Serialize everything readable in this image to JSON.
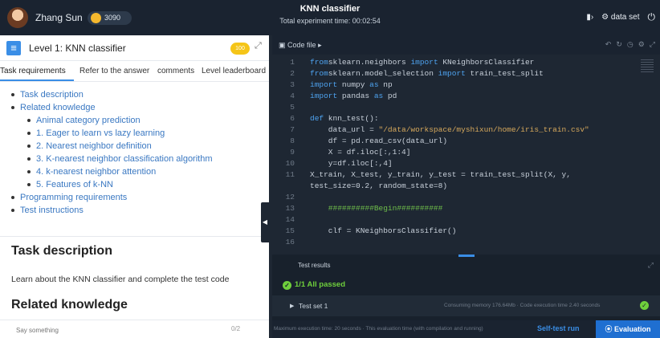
{
  "topbar": {
    "username": "Zhang Sun",
    "coins": "3090",
    "title": "KNN classifier",
    "timer": "Total experiment time: 00:02:54",
    "dataset_label": "data set"
  },
  "left": {
    "level_title": "Level 1: KNN classifier",
    "score": "100",
    "tabs": [
      "Task requirements",
      "Refer to the answer",
      "comments",
      "Level leaderboard"
    ],
    "toc": [
      {
        "label": "Task description",
        "level": 1
      },
      {
        "label": "Related knowledge",
        "level": 1
      },
      {
        "label": "Animal category prediction",
        "level": 2
      },
      {
        "label": "1. Eager to learn vs lazy learning",
        "level": 2
      },
      {
        "label": "2. Nearest neighbor definition",
        "level": 2
      },
      {
        "label": "3. K-nearest neighbor classification algorithm",
        "level": 2
      },
      {
        "label": "4. k-nearest neighbor attention",
        "level": 2
      },
      {
        "label": "5. Features of k-NN",
        "level": 2
      },
      {
        "label": "Programming requirements",
        "level": 1
      },
      {
        "label": "Test instructions",
        "level": 1
      }
    ],
    "section1_title": "Task description",
    "section1_text": "Learn about the KNN classifier and complete the test code",
    "section2_title": "Related knowledge",
    "comment_placeholder": "Say something",
    "comment_count": "0/2"
  },
  "editor": {
    "tab_label": "Code file",
    "lines": [
      {
        "n": "1",
        "parts": [
          [
            "kw",
            "from"
          ],
          [
            "",
            "sklearn.neighbors "
          ],
          [
            "kw",
            "import"
          ],
          [
            "",
            " KNeighborsClassifier"
          ]
        ]
      },
      {
        "n": "2",
        "parts": [
          [
            "kw",
            "from"
          ],
          [
            "",
            "sklearn.model_selection "
          ],
          [
            "kw",
            "import"
          ],
          [
            "",
            " train_test_split"
          ]
        ]
      },
      {
        "n": "3",
        "parts": [
          [
            "kw",
            "import"
          ],
          [
            "",
            " numpy "
          ],
          [
            "kw",
            "as"
          ],
          [
            "",
            " np"
          ]
        ]
      },
      {
        "n": "4",
        "parts": [
          [
            "kw",
            "import"
          ],
          [
            "",
            " pandas "
          ],
          [
            "kw",
            "as"
          ],
          [
            "",
            " pd"
          ]
        ]
      },
      {
        "n": "5",
        "parts": [
          [
            "",
            ""
          ]
        ]
      },
      {
        "n": "6",
        "parts": [
          [
            "kw",
            "def"
          ],
          [
            "",
            " knn_test():"
          ]
        ]
      },
      {
        "n": "7",
        "parts": [
          [
            "",
            "    data_url = "
          ],
          [
            "str",
            "\"/data/workspace/myshixun/home/iris_train.csv\""
          ]
        ]
      },
      {
        "n": "8",
        "parts": [
          [
            "",
            "    df = pd.read_csv(data_url)"
          ]
        ]
      },
      {
        "n": "9",
        "parts": [
          [
            "",
            "    X = df.iloc[:,1:4]"
          ]
        ]
      },
      {
        "n": "10",
        "parts": [
          [
            "",
            "    y=df.iloc[:,4]"
          ]
        ]
      },
      {
        "n": "11",
        "parts": [
          [
            "",
            "X_train, X_test, y_train, y_test = train_test_split(X, y,"
          ]
        ]
      },
      {
        "n": "",
        "parts": [
          [
            "",
            "test_size=0.2, random_state=8)"
          ]
        ]
      },
      {
        "n": "12",
        "parts": [
          [
            "",
            ""
          ]
        ]
      },
      {
        "n": "13",
        "parts": [
          [
            "cm",
            "    ##########Begin##########"
          ]
        ]
      },
      {
        "n": "14",
        "parts": [
          [
            "",
            ""
          ]
        ]
      },
      {
        "n": "15",
        "parts": [
          [
            "",
            "    clf = KNeighborsClassifier()"
          ]
        ]
      },
      {
        "n": "16",
        "parts": [
          [
            "",
            ""
          ]
        ]
      }
    ]
  },
  "results": {
    "title": "Test results",
    "pass_text": "1/1  All passed",
    "test_set": "Test set 1",
    "test_set_info": "Consuming memory 176.64Mb · Code execution time 2.40 seconds",
    "bottom_info": "Maximum execution time: 20 seconds · This evaluation time (with compilation and running)",
    "selftest": "Self-test run",
    "evaluate": "Evaluation"
  }
}
